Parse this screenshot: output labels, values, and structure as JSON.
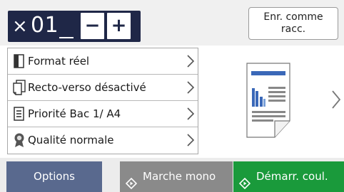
{
  "copies": {
    "prefix": "×",
    "value": "01",
    "decrement_label": "−",
    "increment_label": "+"
  },
  "shortcut": {
    "line1": "Enr. comme",
    "line2": "racc."
  },
  "settings": [
    {
      "icon": "page-size-icon",
      "label": "Format réel"
    },
    {
      "icon": "duplex-icon",
      "label": "Recto-verso désactivé"
    },
    {
      "icon": "tray-list-icon",
      "label": "Priorité Bac 1/ A4"
    },
    {
      "icon": "quality-ribbon-icon",
      "label": "Qualité normale"
    }
  ],
  "preview": {
    "icon": "document-preview-icon"
  },
  "footer": {
    "options": "Options",
    "mono": "Marche mono",
    "color": "Démarr. coul."
  },
  "colors": {
    "counter_bg": "#1f2747",
    "options_bg": "#59698e",
    "mono_bg": "#8a8a8a",
    "color_bg": "#1a9a3b",
    "accent_blue": "#3a68b8"
  }
}
